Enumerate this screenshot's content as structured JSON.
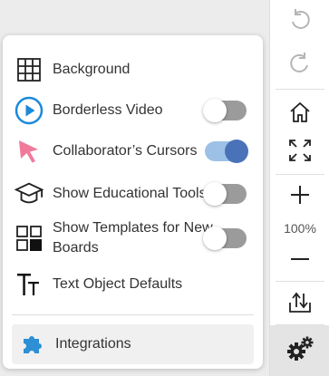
{
  "settings_menu": {
    "items": [
      {
        "label": "Background",
        "icon": "grid-icon",
        "has_toggle": false
      },
      {
        "label": "Borderless Video",
        "icon": "play-circle-icon",
        "has_toggle": true,
        "on": false
      },
      {
        "label": "Collaborator’s Cursors",
        "icon": "cursor-icon",
        "has_toggle": true,
        "on": true
      },
      {
        "label": "Show Educational Tools",
        "icon": "graduation-cap-icon",
        "has_toggle": true,
        "on": false
      },
      {
        "label": "Show Templates for New Boards",
        "icon": "templates-icon",
        "has_toggle": true,
        "on": false
      },
      {
        "label": "Text Object Defaults",
        "icon": "text-tt-icon",
        "has_toggle": false
      }
    ],
    "integrations_label": "Integrations"
  },
  "toolbar": {
    "zoom_level": "100%",
    "buttons": [
      "undo-icon",
      "redo-icon",
      "home-icon",
      "fit-screen-icon",
      "zoom-in-icon",
      "zoom-out-icon",
      "export-icon",
      "settings-icon"
    ]
  },
  "colors": {
    "toggle_on_track": "#9dc1e6",
    "toggle_on_knob": "#4a72b8",
    "toggle_off_track": "#9b9b9b",
    "play_icon": "#1a8ad9",
    "cursor_icon": "#f07a9a",
    "puzzle_icon": "#2d8fd6"
  }
}
